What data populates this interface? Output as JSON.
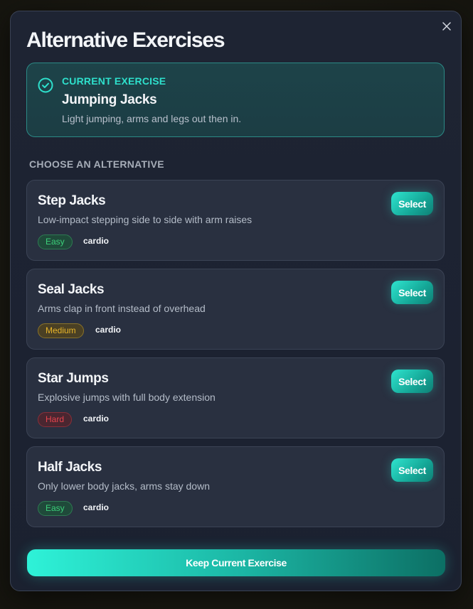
{
  "modal": {
    "title": "Alternative Exercises",
    "close_icon": "close-icon"
  },
  "current": {
    "label": "CURRENT EXERCISE",
    "name": "Jumping Jacks",
    "description": "Light jumping, arms and legs out then in.",
    "icon": "check-circle-icon"
  },
  "section_label": "CHOOSE AN ALTERNATIVE",
  "alternatives": [
    {
      "name": "Step Jacks",
      "description": "Low-impact stepping side to side with arm raises",
      "difficulty": "Easy",
      "category": "cardio",
      "select_label": "Select"
    },
    {
      "name": "Seal Jacks",
      "description": "Arms clap in front instead of overhead",
      "difficulty": "Medium",
      "category": "cardio",
      "select_label": "Select"
    },
    {
      "name": "Star Jumps",
      "description": "Explosive jumps with full body extension",
      "difficulty": "Hard",
      "category": "cardio",
      "select_label": "Select"
    },
    {
      "name": "Half Jacks",
      "description": "Only lower body jacks, arms stay down",
      "difficulty": "Easy",
      "category": "cardio",
      "select_label": "Select"
    }
  ],
  "keep_button_label": "Keep Current Exercise",
  "colors": {
    "accent": "#2ee0cc",
    "easy": "#3ccf7a",
    "medium": "#e8b52a",
    "hard": "#e8444e"
  }
}
